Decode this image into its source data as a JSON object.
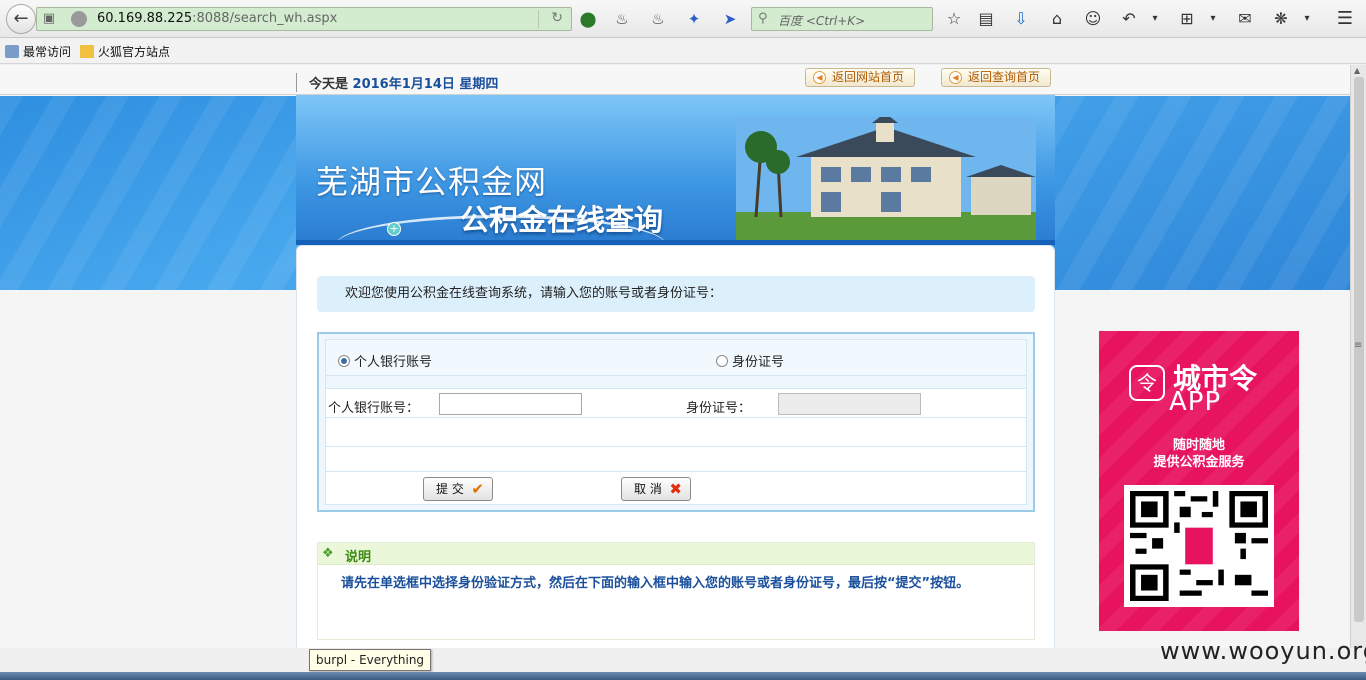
{
  "browser": {
    "url_host": "60.169.88.225",
    "url_rest": ":8088/search_wh.aspx",
    "search_placeholder": "百度 <Ctrl+K>",
    "bookmarks": [
      "最常访问",
      "火狐官方站点"
    ]
  },
  "header": {
    "date_prefix": "今天是",
    "date_value": "2016年1月14日 星期四",
    "nav_home": "返回网站首页",
    "nav_query_home": "返回查询首页"
  },
  "banner": {
    "site_title": "芜湖市公积金网",
    "subtitle": "公积金在线查询"
  },
  "main": {
    "welcome": "欢迎您使用公积金在线查询系统，请输入您的账号或者身份证号：",
    "radio_account": "个人银行账号",
    "radio_id": "身份证号",
    "selected_mode": "account",
    "label_account": "个人银行账号：",
    "label_id": "身份证号：",
    "account_value": "",
    "id_value": "",
    "submit_label": "提 交",
    "cancel_label": "取 消"
  },
  "note": {
    "title": "说明",
    "text": "请先在单选框中选择身份验证方式，然后在下面的输入框中输入您的账号或者身份证号，最后按“提交”按钮。"
  },
  "promo": {
    "brand": "城市令",
    "app": "APP",
    "slogan_line1": "随时随地",
    "slogan_line2": "提供公积金服务"
  },
  "tooltip": "burpl - Everything",
  "watermark": "www.wooyun.org",
  "colors": {
    "banner_blue": "#2f8fe0",
    "promo_pink": "#e8135f",
    "note_green": "#3d8a12",
    "text_blue": "#1a4f9c"
  }
}
